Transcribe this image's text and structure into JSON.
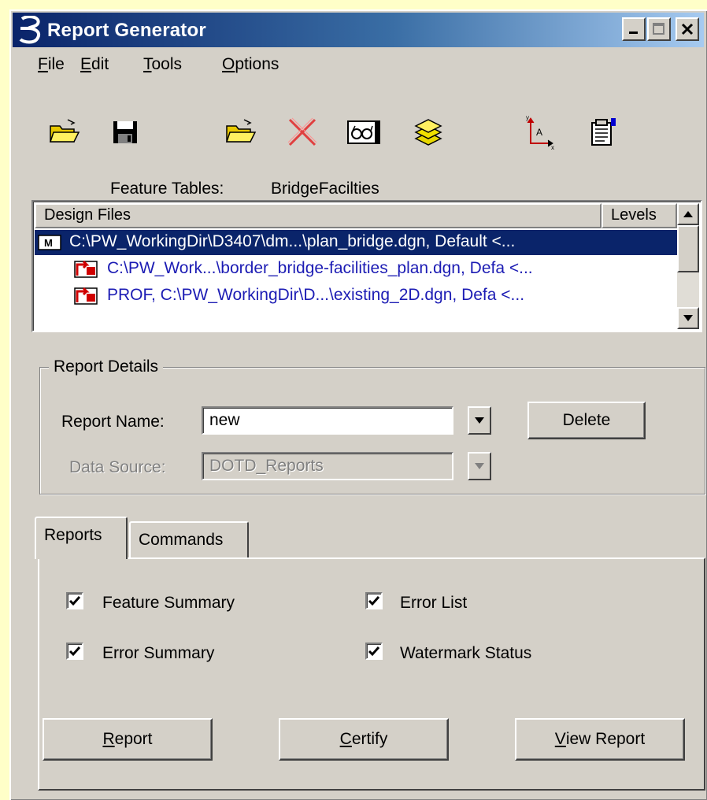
{
  "window": {
    "title": "Report Generator"
  },
  "menu": {
    "items": [
      {
        "label": "File"
      },
      {
        "label": "Edit"
      },
      {
        "label": "Tools"
      },
      {
        "label": "Options"
      }
    ]
  },
  "toolbar": {
    "icons": [
      "open-folder-icon",
      "save-icon",
      "open-icon",
      "delete-x-icon",
      "glasses-view-icon",
      "layers-icon",
      "axis-coordinates-icon",
      "properties-icon"
    ]
  },
  "feature_tables": {
    "label": "Feature Tables:",
    "value": "BridgeFacilties"
  },
  "design_files": {
    "columns": [
      "Design Files",
      "Levels"
    ],
    "rows": [
      {
        "text": "C:\\PW_WorkingDir\\D3407\\dm...\\plan_bridge.dgn, Default <...",
        "selected": true,
        "icon": "master-model-icon"
      },
      {
        "text": "C:\\PW_Work...\\border_bridge-facilities_plan.dgn, Defa <...",
        "selected": false,
        "icon": "reference-file-icon"
      },
      {
        "text": "PROF, C:\\PW_WorkingDir\\D...\\existing_2D.dgn, Defa <...",
        "selected": false,
        "icon": "reference-file-icon"
      }
    ]
  },
  "report_details": {
    "title": "Report Details",
    "report_name_label": "Report Name:",
    "report_name_value": "new",
    "data_source_label": "Data Source:",
    "data_source_value": "DOTD_Reports",
    "delete_label": "Delete"
  },
  "tabs": {
    "items": [
      {
        "label": "Reports",
        "active": true
      },
      {
        "label": "Commands",
        "active": false
      }
    ]
  },
  "reports": {
    "checkboxes": [
      {
        "label": "Feature Summary",
        "checked": true
      },
      {
        "label": "Error List",
        "checked": true
      },
      {
        "label": "Error Summary",
        "checked": true
      },
      {
        "label": "Watermark Status",
        "checked": true
      }
    ],
    "buttons": {
      "report": {
        "mnemonic": "R",
        "rest": "eport"
      },
      "certify": {
        "mnemonic": "C",
        "rest": "ertify"
      },
      "view_report": {
        "mnemonic": "V",
        "rest": "iew Report"
      }
    }
  }
}
